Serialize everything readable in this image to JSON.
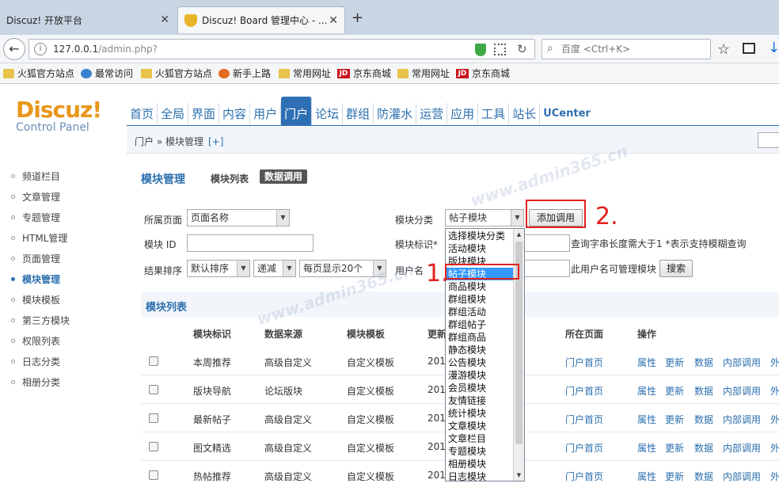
{
  "browser": {
    "tabs": [
      {
        "title": "Discuz! 开放平台"
      },
      {
        "title": "Discuz! Board 管理中心 - ..."
      }
    ],
    "url_host": "127.0.0.1",
    "url_path": "/admin.php?",
    "search_placeholder": "百度 <Ctrl+K>",
    "bookmarks": [
      "火狐官方站点",
      "最常访问",
      "火狐官方站点",
      "新手上路",
      "常用网址",
      "京东商城",
      "常用网址",
      "京东商城"
    ]
  },
  "logo": {
    "brand": "Discuz!",
    "sub": "Control Panel"
  },
  "nav": [
    "首页",
    "全局",
    "界面",
    "内容",
    "用户",
    "门户",
    "论坛",
    "群组",
    "防灌水",
    "运营",
    "应用",
    "工具",
    "站长",
    "UCenter"
  ],
  "nav_active": "门户",
  "breadcrumb": {
    "path": "门户 » 模块管理",
    "plus": "[+]"
  },
  "sidebar": [
    "频道栏目",
    "文章管理",
    "专题管理",
    "HTML管理",
    "页面管理",
    "模块管理",
    "模块模板",
    "第三方模块",
    "权限列表",
    "日志分类",
    "相册分类"
  ],
  "sidebar_active": "模块管理",
  "page": {
    "title": "模块管理",
    "tab_list": "模块列表",
    "tab_data": "数据调用"
  },
  "filters": {
    "page_label": "所属页面",
    "page_value": "页面名称",
    "category_label": "模块分类",
    "category_value": "帖子模块",
    "add_button": "添加调用",
    "id_label": "模块 ID",
    "mark_label": "模块标识*",
    "hint": "查询字串长度需大于1   *表示支持模糊查询",
    "sort_label": "结果排序",
    "sort_value": "默认排序",
    "order_value": "递减",
    "perpage_value": "每页显示20个",
    "user_label": "用户名",
    "user_hint": "此用户名可管理模块",
    "search_button": "搜索"
  },
  "dropdown": {
    "options": [
      "选择模块分类",
      "活动模块",
      "版块模块",
      "帖子模块",
      "商品模块",
      "群组模块",
      "群组活动",
      "群组帖子",
      "群组商品",
      "静态模块",
      "公告模块",
      "漫游模块",
      "会员模块",
      "友情链接",
      "统计模块",
      "文章模块",
      "文章栏目",
      "专题模块",
      "相册模块",
      "日志模块"
    ],
    "selected": "帖子模块"
  },
  "list": {
    "title": "模块列表",
    "columns": [
      "模块标识",
      "数据来源",
      "模块模板",
      "更新",
      "所在页面",
      "操作"
    ],
    "rows": [
      {
        "name": "本周推荐",
        "source": "高级自定义",
        "template": "自定义模板",
        "date": "201",
        "page": "门户首页"
      },
      {
        "name": "版块导航",
        "source": "论坛版块",
        "template": "自定义模板",
        "date": "201",
        "page": "门户首页"
      },
      {
        "name": "最新帖子",
        "source": "高级自定义",
        "template": "自定义模板",
        "date": "201",
        "page": "门户首页"
      },
      {
        "name": "图文精选",
        "source": "高级自定义",
        "template": "自定义模板",
        "date": "201",
        "page": "门户首页"
      },
      {
        "name": "热帖推荐",
        "source": "高级自定义",
        "template": "自定义模板",
        "date": "201",
        "page": "门户首页"
      }
    ],
    "ops": [
      "属性",
      "更新",
      "数据",
      "内部调用",
      "外"
    ]
  },
  "annotations": {
    "mark1": "1.",
    "mark2": "2."
  },
  "watermark": "www.admin365.cn",
  "colors": {
    "accent": "#2e6fb4",
    "logo": "#e8961a",
    "annotation": "#e02020",
    "selected_option": "#3399ff"
  }
}
